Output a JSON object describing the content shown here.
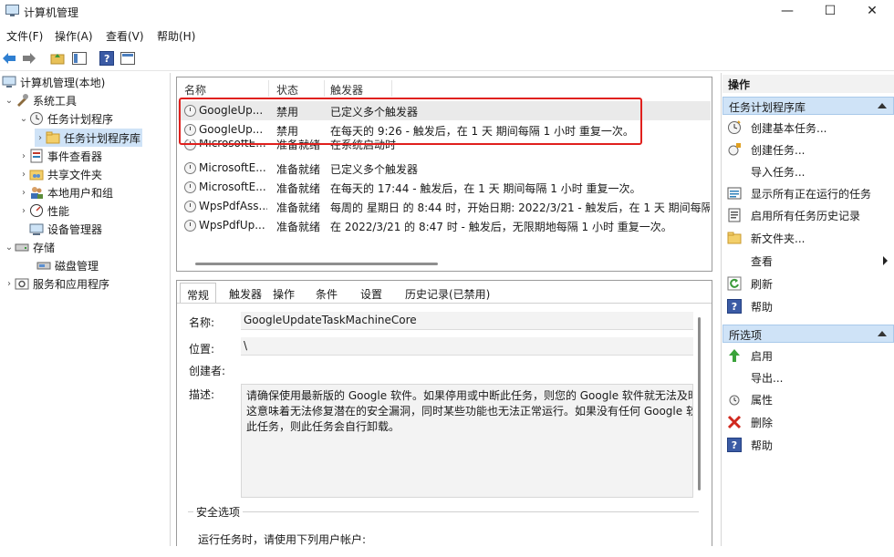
{
  "window": {
    "title": "计算机管理",
    "minimize": "—",
    "maximize": "☐",
    "close": "✕"
  },
  "menu": [
    "文件(F)",
    "操作(A)",
    "查看(V)",
    "帮助(H)"
  ],
  "tree": {
    "root": "计算机管理(本地)",
    "system_tools": "系统工具",
    "task_scheduler": "任务计划程序",
    "task_library": "任务计划程序库",
    "event_viewer": "事件查看器",
    "shared_folders": "共享文件夹",
    "local_users": "本地用户和组",
    "performance": "性能",
    "device_manager": "设备管理器",
    "storage": "存储",
    "disk_mgmt": "磁盘管理",
    "services": "服务和应用程序"
  },
  "tasks": {
    "columns": [
      "名称",
      "状态",
      "触发器"
    ],
    "rows": [
      {
        "name": "GoogleUp...",
        "status": "禁用",
        "trigger": "已定义多个触发器"
      },
      {
        "name": "GoogleUp...",
        "status": "禁用",
        "trigger": "在每天的 9:26 - 触发后，在 1 天 期间每隔 1 小时 重复一次。"
      },
      {
        "name": "MicrosoftE...",
        "status": "准备就绪",
        "trigger": "在系统启动时"
      },
      {
        "name": "MicrosoftE...",
        "status": "准备就绪",
        "trigger": "已定义多个触发器"
      },
      {
        "name": "MicrosoftE...",
        "status": "准备就绪",
        "trigger": "在每天的 17:44 - 触发后，在 1 天 期间每隔 1 小时 重复一次。"
      },
      {
        "name": "WpsPdfAss...",
        "status": "准备就绪",
        "trigger": "每周的 星期日 的 8:44 时，开始日期: 2022/3/21 - 触发后，在 1 天 期间每隔"
      },
      {
        "name": "WpsPdfUp...",
        "status": "准备就绪",
        "trigger": "在 2022/3/21 的 8:47 时 - 触发后，无限期地每隔 1 小时 重复一次。"
      }
    ]
  },
  "detail": {
    "tabs": [
      "常规",
      "触发器",
      "操作",
      "条件",
      "设置",
      "历史记录(已禁用)"
    ],
    "name_label": "名称:",
    "name_value": "GoogleUpdateTaskMachineCore",
    "location_label": "位置:",
    "location_value": "\\",
    "author_label": "创建者:",
    "desc_label": "描述:",
    "desc_lines": [
      "请确保使用最新版的 Google 软件。如果停用或中断此任务，则您的 Google 软件就无法及时",
      "这意味着无法修复潜在的安全漏洞，同时某些功能也无法正常运行。如果没有任何 Google 软",
      "此任务，则此任务会自行卸载。"
    ],
    "security_legend": "安全选项",
    "security_text": "运行任务时，请使用下列用户帐户:"
  },
  "actions": {
    "header": "操作",
    "section1": "任务计划程序库",
    "section1_items": [
      "创建基本任务...",
      "创建任务...",
      "导入任务...",
      "显示所有正在运行的任务",
      "启用所有任务历史记录",
      "新文件夹...",
      "查看",
      "刷新",
      "帮助"
    ],
    "section2": "所选项",
    "section2_items": [
      "启用",
      "导出...",
      "属性",
      "删除",
      "帮助"
    ]
  },
  "colors": {
    "accent_selection": "#cfe3f7",
    "highlight_box": "#e0201d"
  }
}
